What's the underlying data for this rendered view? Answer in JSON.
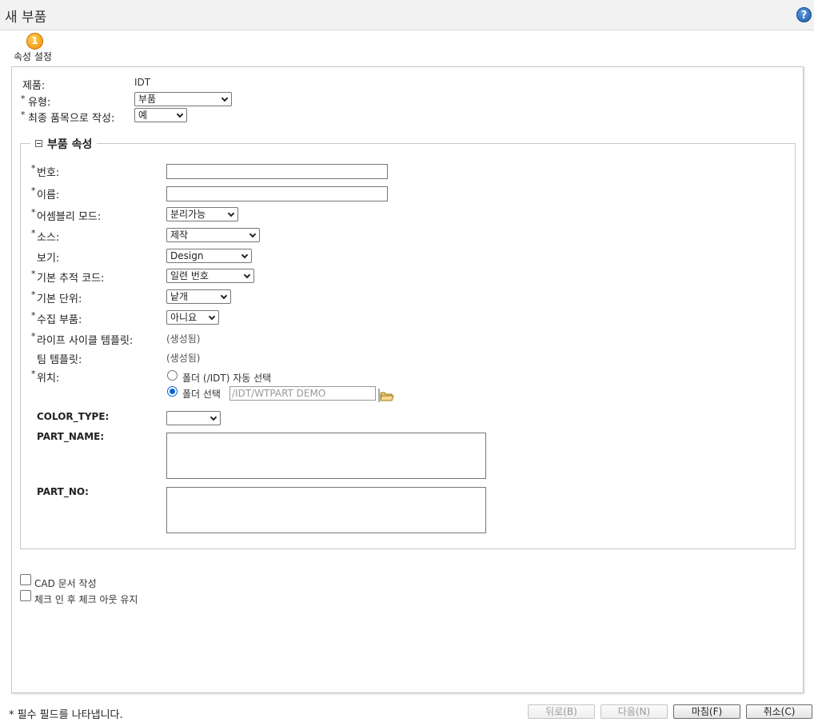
{
  "window": {
    "title": "새 부품"
  },
  "wizard": {
    "step_label": "속성 설정",
    "step_number": "1"
  },
  "header_fields": {
    "product_label": "제품:",
    "product_value": "IDT",
    "type_label": "유형:",
    "type_value": "부품",
    "final_item_label": "최종 품목으로 작성:",
    "final_item_value": "예"
  },
  "section": {
    "title": "부품 속성"
  },
  "fields": {
    "number_label": "번호:",
    "number_value": "",
    "name_label": "이름:",
    "name_value": "",
    "assembly_mode_label": "어셈블리 모드:",
    "assembly_mode_value": "분리가능",
    "source_label": "소스:",
    "source_value": "제작",
    "view_label": "보기:",
    "view_value": "Design",
    "trace_code_label": "기본 추적 코드:",
    "trace_code_value": "일련 번호",
    "unit_label": "기본 단위:",
    "unit_value": "낱개",
    "gathering_label": "수집 부품:",
    "gathering_value": "아니요",
    "lifecycle_label": "라이프 사이클 템플릿:",
    "lifecycle_value": "(생성됨)",
    "team_label": "팀 템플릿:",
    "team_value": "(생성됨)",
    "location_label": "위치:",
    "location_auto_label": "폴더 (/IDT) 자동 선택",
    "location_select_label": "폴더 선택",
    "location_path": "/IDT/WTPART DEMO",
    "color_type_label": "COLOR_TYPE:",
    "color_type_value": "",
    "part_name_label": "PART_NAME:",
    "part_name_value": "",
    "part_no_label": "PART_NO:",
    "part_no_value": ""
  },
  "options": {
    "cad_doc_label": "CAD 문서 작성",
    "keep_checkout_label": "체크 인 후 체크 아웃 유지"
  },
  "required_mark": "*",
  "footer": {
    "note": "* 필수 필드를 나타냅니다.",
    "back": "뒤로(B)",
    "next": "다음(N)",
    "finish": "마침(F)",
    "cancel": "취소(C)"
  },
  "colors": {
    "accent": "#0a64d8",
    "step_icon": "#f08a00",
    "help_icon": "#1c5aa8"
  }
}
